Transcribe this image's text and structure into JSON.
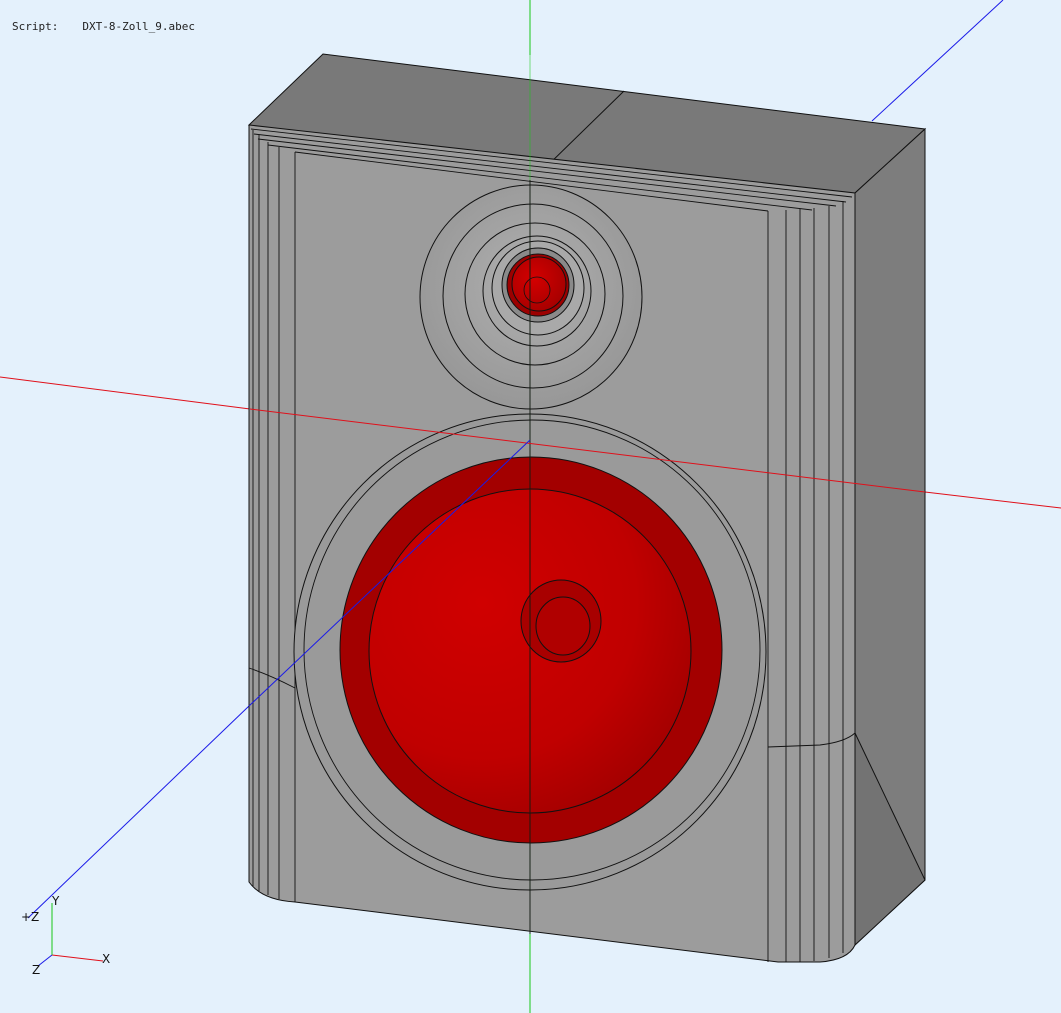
{
  "script": {
    "label": "Script:",
    "file": "DXT-8-Zoll_9.abec"
  },
  "triad": {
    "x_label": "X",
    "y_label": "Y",
    "z_label": "Z",
    "z_plus_label": "+Z"
  },
  "colors": {
    "background": "#e4f1fc",
    "cabinet_front": "#9c9c9c",
    "cabinet_top": "#797979",
    "cabinet_side": "#7d7d7d",
    "driver_red": "#c40000",
    "driver_dark_red": "#a00000",
    "axis_x": "#e0101a",
    "axis_y": "#18c818",
    "axis_z": "#1a1ae8"
  }
}
